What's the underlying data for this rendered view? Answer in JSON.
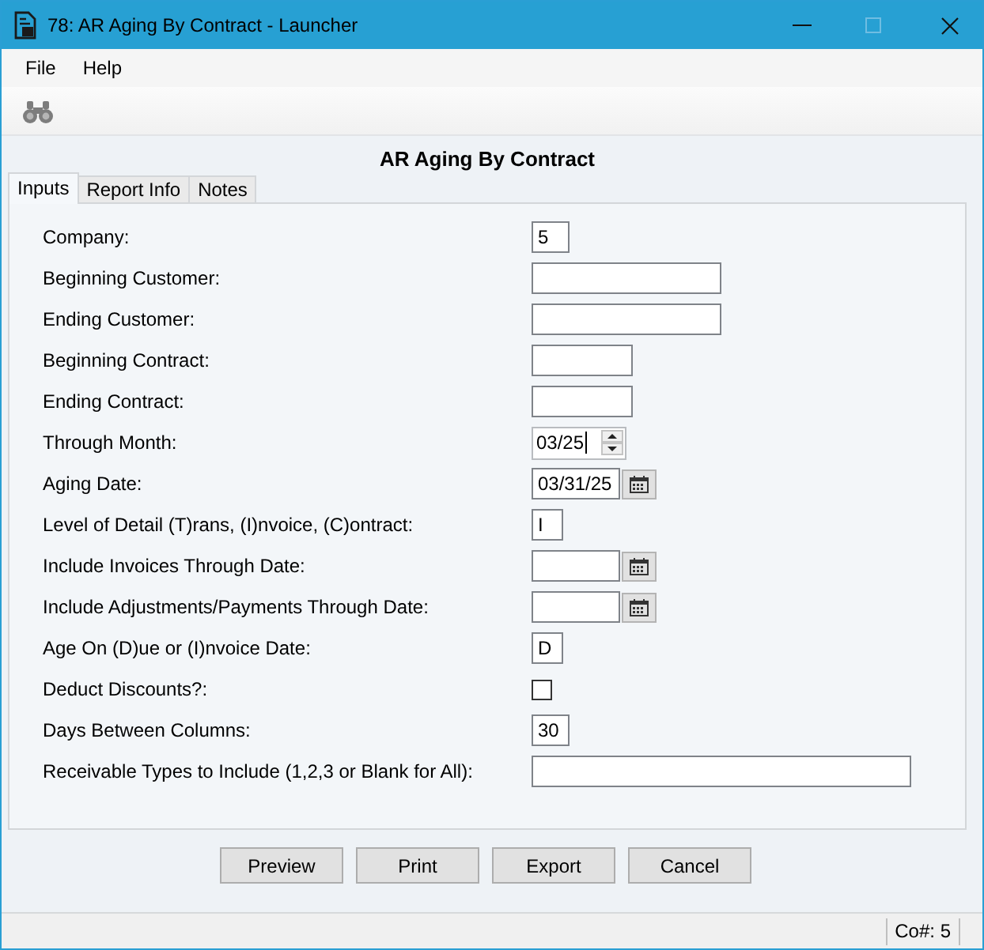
{
  "window": {
    "title": "78: AR Aging By Contract - Launcher"
  },
  "menu": [
    "File",
    "Help"
  ],
  "report_title": "AR Aging By Contract",
  "tabs": [
    {
      "label": "Inputs",
      "selected": true
    },
    {
      "label": "Report Info",
      "selected": false
    },
    {
      "label": "Notes",
      "selected": false
    }
  ],
  "fields": [
    {
      "label": "Company:",
      "kind": "text",
      "value": "5",
      "focused": false
    },
    {
      "label": "Beginning Customer:",
      "kind": "text",
      "focused": false
    },
    {
      "label": "Ending Customer:",
      "kind": "text",
      "focused": false
    },
    {
      "label": "Beginning Contract:",
      "kind": "text",
      "focused": false
    },
    {
      "label": "Ending Contract:",
      "kind": "text",
      "focused": false
    },
    {
      "label": "Through Month:",
      "kind": "spinner",
      "value": "03/25",
      "focused": true
    },
    {
      "label": "Aging Date:",
      "kind": "date",
      "value": "03/31/25",
      "focused": false
    },
    {
      "label": "Level of Detail (T)rans, (I)nvoice, (C)ontract:",
      "kind": "text",
      "value": "I",
      "focused": false
    },
    {
      "label": "Include Invoices Through Date:",
      "kind": "date",
      "focused": false
    },
    {
      "label": "Include Adjustments/Payments Through Date:",
      "kind": "date",
      "focused": false
    },
    {
      "label": "Age On (D)ue or (I)nvoice Date:",
      "kind": "text",
      "value": "D",
      "focused": false
    },
    {
      "label": "Deduct Discounts?:",
      "kind": "checkbox",
      "checked": false,
      "focused": false
    },
    {
      "label": "Days Between Columns:",
      "kind": "text",
      "value": "30",
      "focused": false
    },
    {
      "label": "Receivable Types to Include (1,2,3 or Blank for All):",
      "kind": "text",
      "focused": false
    }
  ],
  "buttons": [
    "Preview",
    "Print",
    "Export",
    "Cancel"
  ],
  "status_bar": {
    "company": "Co#: 5"
  }
}
